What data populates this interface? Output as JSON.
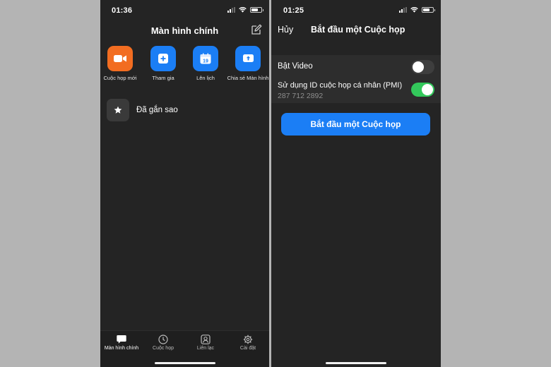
{
  "left": {
    "time": "01:36",
    "title": "Màn hình chính",
    "actions": [
      {
        "label": "Cuộc họp mới",
        "icon": "video-camera-icon",
        "color": "#f26d21"
      },
      {
        "label": "Tham gia",
        "icon": "plus-icon",
        "color": "#1b7ef5"
      },
      {
        "label": "Lên lịch",
        "icon": "calendar-icon",
        "color": "#1b7ef5",
        "calendar_day": "19"
      },
      {
        "label": "Chia sẻ Màn hình",
        "icon": "share-screen-icon",
        "color": "#1b7ef5"
      }
    ],
    "starred_label": "Đã gắn sao",
    "tabs": [
      {
        "label": "Màn hình chính",
        "icon": "chat-bubble-icon",
        "active": true
      },
      {
        "label": "Cuộc họp",
        "icon": "clock-icon",
        "active": false
      },
      {
        "label": "Liên lạc",
        "icon": "contact-icon",
        "active": false
      },
      {
        "label": "Cài đặt",
        "icon": "gear-icon",
        "active": false
      }
    ]
  },
  "right": {
    "time": "01:25",
    "cancel_label": "Hủy",
    "title": "Bắt đầu một Cuộc họp",
    "video_label": "Bật Video",
    "video_on": false,
    "pmi_label": "Sử dụng ID cuộc họp cá nhân (PMI)",
    "pmi_number": "287 712 2892",
    "pmi_on": true,
    "start_button_label": "Bắt đầu một Cuộc họp"
  },
  "colors": {
    "background": "#b4b4b4",
    "panel": "#242424",
    "accent_blue": "#1b7ef5",
    "accent_orange": "#f26d21",
    "toggle_on": "#33c85b"
  }
}
